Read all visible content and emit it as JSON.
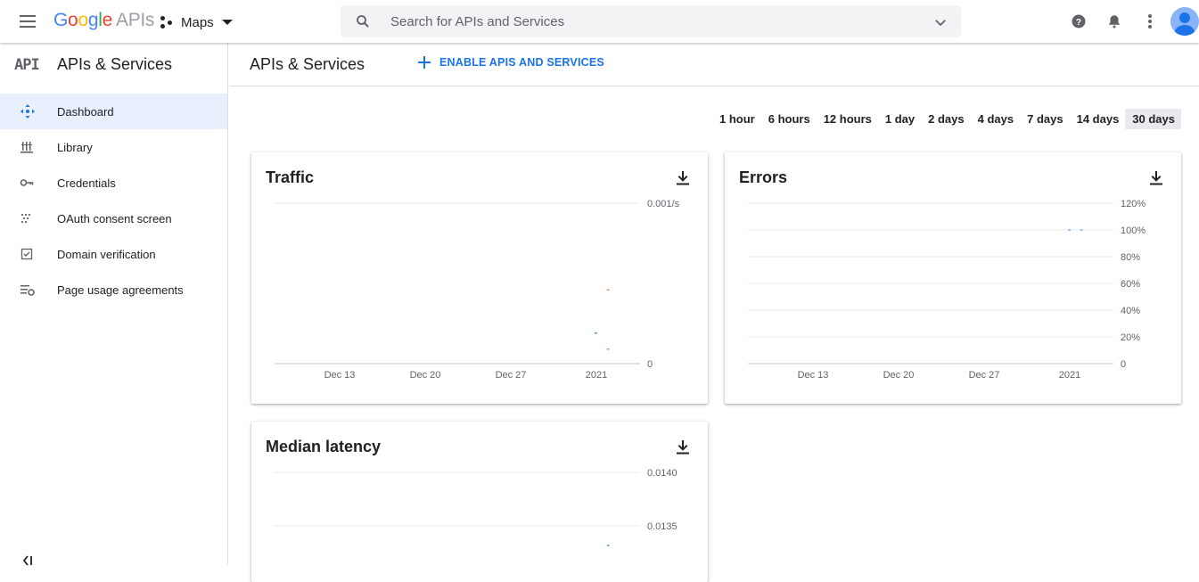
{
  "header": {
    "logo_google": "Google",
    "logo_apis": "APIs",
    "project_name": "Maps",
    "search_placeholder": "Search for APIs and Services",
    "icons": [
      "menu-icon",
      "search-icon",
      "chevron-down-icon",
      "help-icon",
      "notifications-icon",
      "more-vert-icon",
      "avatar"
    ]
  },
  "sidebar": {
    "logo_text": "API",
    "title": "APIs & Services",
    "items": [
      {
        "label": "Dashboard",
        "icon": "dashboard-icon",
        "active": true
      },
      {
        "label": "Library",
        "icon": "library-icon",
        "active": false
      },
      {
        "label": "Credentials",
        "icon": "key-icon",
        "active": false
      },
      {
        "label": "OAuth consent screen",
        "icon": "oauth-icon",
        "active": false
      },
      {
        "label": "Domain verification",
        "icon": "checkbox-icon",
        "active": false
      },
      {
        "label": "Page usage agreements",
        "icon": "settings-list-icon",
        "active": false
      }
    ]
  },
  "main": {
    "title": "APIs & Services",
    "enable_label": "ENABLE APIS AND SERVICES",
    "time_ranges": [
      "1 hour",
      "6 hours",
      "12 hours",
      "1 day",
      "2 days",
      "4 days",
      "7 days",
      "14 days",
      "30 days"
    ],
    "selected_range": "30 days"
  },
  "colors": {
    "accent": "#1a73e8",
    "active_bg": "#e8f0fe",
    "series_orange": "#f4511e",
    "series_green": "#0b8043",
    "series_blue": "#4285f4"
  },
  "chart_data": [
    {
      "type": "line",
      "title": "Traffic",
      "x_ticks": [
        "Dec 13",
        "Dec 20",
        "Dec 27",
        "2021"
      ],
      "y_ticks": [
        "0.001/s",
        "0"
      ],
      "ylim": [
        0,
        0.001
      ],
      "grid": true,
      "series": [
        {
          "values": [
            {
              "x": "2021-01-04",
              "y": 0.00046
            }
          ],
          "color": "#f4511e"
        },
        {
          "values": [
            {
              "x": "2021-01-03",
              "y": 0.00019
            }
          ],
          "color": "#0b8043"
        },
        {
          "values": [
            {
              "x": "2021-01-04",
              "y": 9e-05
            }
          ],
          "color": "#4285f4"
        }
      ]
    },
    {
      "type": "line",
      "title": "Errors",
      "x_ticks": [
        "Dec 13",
        "Dec 20",
        "Dec 27",
        "2021"
      ],
      "y_ticks": [
        "120%",
        "100%",
        "80%",
        "60%",
        "40%",
        "20%",
        "0"
      ],
      "ylim": [
        0,
        120
      ],
      "grid": true,
      "series": [
        {
          "values": [
            {
              "x": "2021-01-03",
              "y": 100
            },
            {
              "x": "2021-01-04",
              "y": 100
            }
          ],
          "color": "#4285f4"
        }
      ]
    },
    {
      "type": "line",
      "title": "Median latency",
      "x_ticks": [],
      "y_ticks": [
        "0.0140",
        "0.0135"
      ],
      "grid": true,
      "series": [
        {
          "values": [
            {
              "x": "2021-01-04",
              "y": 0.0132
            }
          ],
          "color": "#0b8043"
        }
      ]
    }
  ]
}
